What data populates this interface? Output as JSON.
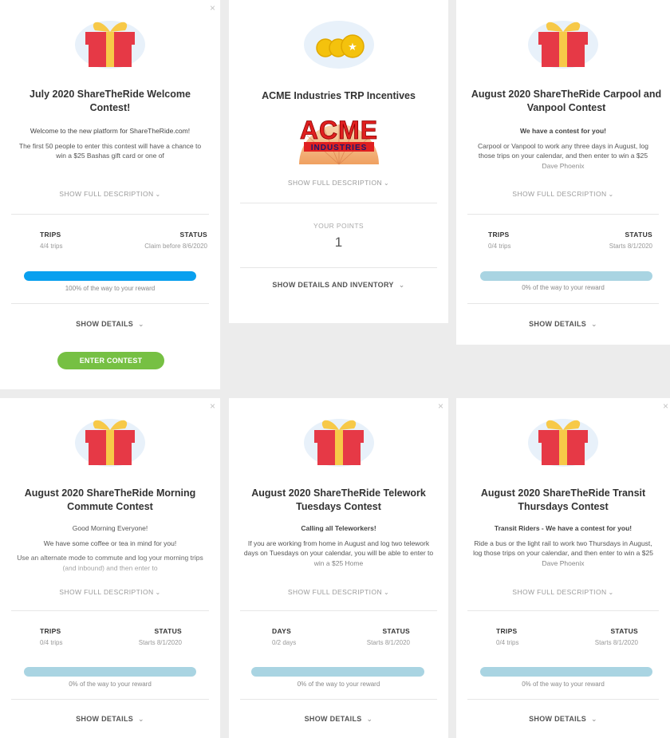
{
  "icons": {
    "close": "×",
    "chevron": "❯",
    "gift_colors": {
      "box": "#e63946",
      "ribbon": "#f7c948",
      "blob": "#e8f1fa"
    },
    "coins_color": "#f4c20d"
  },
  "contests": [
    {
      "title": "July 2020 ShareTheRide Welcome Contest!",
      "description": [
        "Welcome to the new platform for ShareTheRide.com!",
        "The first 50 people to enter this contest will have a chance to win a $25 Bashas gift card or one of"
      ],
      "show_full_label": "SHOW FULL DESCRIPTION",
      "stats": {
        "left_label": "TRIPS",
        "left_value": "4/4 trips",
        "right_label": "STATUS",
        "right_value": "Claim before 8/6/2020"
      },
      "progress": 1.0,
      "progress_caption": "100% of the way to your reward",
      "show_details_label": "SHOW DETAILS",
      "enter_label": "ENTER CONTEST"
    },
    {
      "title": "ACME Industries TRP Incentives",
      "logo_text_top": "ACME",
      "logo_text_bottom": "INDUSTRIES",
      "show_full_label": "SHOW FULL DESCRIPTION",
      "points_label": "YOUR POINTS",
      "points_value": "1",
      "show_details_label": "SHOW DETAILS AND INVENTORY"
    },
    {
      "title": "August 2020 ShareTheRide Carpool and Vanpool Contest",
      "description": [
        "We have a contest for you!",
        "Carpool or Vanpool to work any three days in August, log those trips on your calendar, and then enter to win a $25 Dave Phoenix"
      ],
      "show_full_label": "SHOW FULL DESCRIPTION",
      "stats": {
        "left_label": "TRIPS",
        "left_value": "0/4 trips",
        "right_label": "STATUS",
        "right_value": "Starts 8/1/2020"
      },
      "progress": 0.0,
      "progress_caption": "0% of the way to your reward",
      "show_details_label": "SHOW DETAILS"
    },
    {
      "title": "August 2020 ShareTheRide Morning Commute Contest",
      "description": [
        "Good Morning Everyone!",
        "We have some coffee or tea in mind for you!",
        "Use an alternate mode to commute and log your morning trips (and inbound) and then enter to"
      ],
      "show_full_label": "SHOW FULL DESCRIPTION",
      "stats": {
        "left_label": "TRIPS",
        "left_value": "0/4 trips",
        "right_label": "STATUS",
        "right_value": "Starts 8/1/2020"
      },
      "progress": 0.0,
      "progress_caption": "0% of the way to your reward",
      "show_details_label": "SHOW DETAILS"
    },
    {
      "title": "August 2020 ShareTheRide Telework Tuesdays Contest",
      "description": [
        "Calling all Teleworkers!",
        "If you are working from home in August and log two telework days on Tuesdays on your calendar, you will be able to enter to win a $25 Home"
      ],
      "show_full_label": "SHOW FULL DESCRIPTION",
      "stats": {
        "left_label": "DAYS",
        "left_value": "0/2 days",
        "right_label": "STATUS",
        "right_value": "Starts 8/1/2020"
      },
      "progress": 0.0,
      "progress_caption": "0% of the way to your reward",
      "show_details_label": "SHOW DETAILS"
    },
    {
      "title": "August 2020 ShareTheRide Transit Thursdays Contest",
      "description": [
        "Transit Riders - We have a contest for you!",
        "Ride a bus or the light rail to work two Thursdays in August, log those trips on your calendar, and then enter to win a $25 Dave Phoenix"
      ],
      "show_full_label": "SHOW FULL DESCRIPTION",
      "stats": {
        "left_label": "TRIPS",
        "left_value": "0/4 trips",
        "right_label": "STATUS",
        "right_value": "Starts 8/1/2020"
      },
      "progress": 0.0,
      "progress_caption": "0% of the way to your reward",
      "show_details_label": "SHOW DETAILS"
    }
  ]
}
